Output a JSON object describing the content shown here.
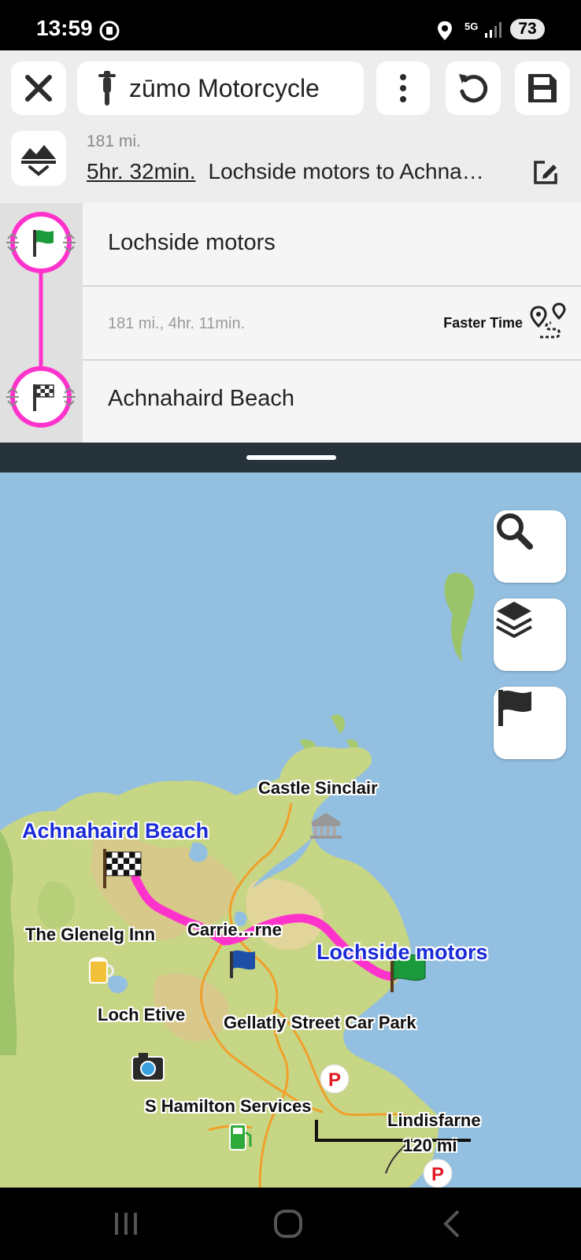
{
  "status_bar": {
    "time": "13:59",
    "network": "5G",
    "battery": "73"
  },
  "toolbar": {
    "close_icon": "close-icon",
    "profile_label": "zūmo Motorcycle",
    "more_icon": "more-vertical-icon",
    "undo_icon": "undo-icon",
    "save_icon": "save-icon"
  },
  "route_summary": {
    "distance": "181 mi.",
    "duration": "5hr. 32min.",
    "name": "Lochside motors to Achna…"
  },
  "stops": {
    "start": {
      "label": "Lochside motors",
      "icon": "green-flag-icon"
    },
    "leg": {
      "info": "181 mi., 4hr. 11min.",
      "route_type": "Faster Time"
    },
    "end": {
      "label": "Achnahaird Beach",
      "icon": "checkered-flag-icon"
    }
  },
  "map": {
    "labels": {
      "castle": "Castle Sinclair",
      "achnahaird": "Achnahaird Beach",
      "glenelg": "The Glenelg Inn",
      "carrie": "Carrie…rne",
      "lochside": "Lochside motors",
      "loch_etive": "Loch Etive",
      "gellatly": "Gellatly Street Car Park",
      "hamilton": "S Hamilton Services",
      "lindisfarne": "Lindisfarne"
    },
    "scale": "120 mi",
    "route_color": "#ff33cc",
    "buttons": [
      "search-icon",
      "layers-icon",
      "flag-icon"
    ]
  }
}
